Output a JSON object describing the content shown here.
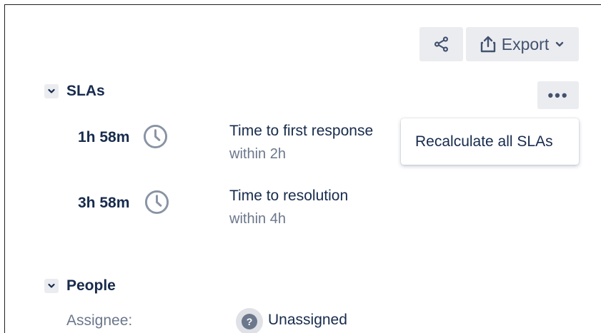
{
  "toolbar": {
    "share_icon": "share-icon",
    "export_label": "Export",
    "export_icon": "export-icon",
    "more_label": "•••"
  },
  "slas": {
    "title": "SLAs",
    "items": [
      {
        "time": "1h 58m",
        "name": "Time to first response",
        "goal": "within 2h"
      },
      {
        "time": "3h 58m",
        "name": "Time to resolution",
        "goal": "within 4h"
      }
    ]
  },
  "menu": {
    "item": "Recalculate all SLAs"
  },
  "people": {
    "title": "People",
    "assignee_label": "Assignee:",
    "assignee_value": "Unassigned",
    "avatar_glyph": "?"
  },
  "colors": {
    "text": "#172b4d",
    "subtle": "#6b778c",
    "button_bg": "#ebecf0",
    "icon": "#42526e"
  }
}
